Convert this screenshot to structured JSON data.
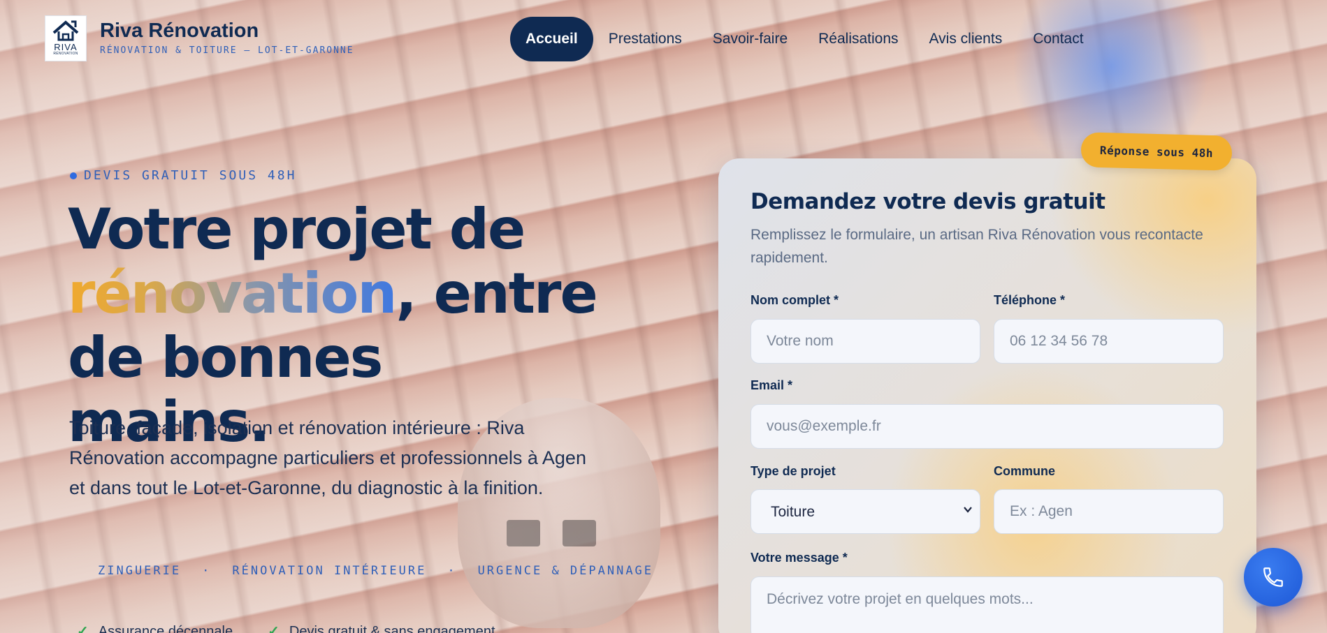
{
  "brand": {
    "name": "Riva Rénovation",
    "tagline": "RÉNOVATION & TOITURE — LOT-ET-GARONNE",
    "logo_word": "RIVA",
    "logo_small": "RÉNOVATION"
  },
  "nav": {
    "items": [
      {
        "label": "Accueil",
        "active": true
      },
      {
        "label": "Prestations"
      },
      {
        "label": "Savoir-faire"
      },
      {
        "label": "Réalisations"
      },
      {
        "label": "Avis clients"
      },
      {
        "label": "Contact"
      }
    ]
  },
  "hero": {
    "eyebrow": "DEVIS GRATUIT SOUS 48H",
    "title_line1": "Votre projet de",
    "title_highlight": "rénovation",
    "title_after_highlight": ", entre",
    "title_line3": "de bonnes mains.",
    "lead": "Toiture, façade, isolation et rénovation intérieure : Riva Rénovation accompagne particuliers et professionnels à Agen et dans tout le Lot-et-Garonne, du diagnostic à la finition.",
    "ticker": [
      "ZINGUERIE",
      "·",
      "RÉNOVATION INTÉRIEURE",
      "·",
      "URGENCE & DÉPANNAGE"
    ],
    "checks": [
      "Assurance décennale",
      "Devis gratuit & sans engagement"
    ]
  },
  "form": {
    "badge": "Réponse sous 48h",
    "title": "Demandez votre devis gratuit",
    "subtitle": "Remplissez le formulaire, un artisan Riva Rénovation vous recontacte rapidement.",
    "name_label": "Nom complet *",
    "name_placeholder": "Votre nom",
    "phone_label": "Téléphone *",
    "phone_placeholder": "06 12 34 56 78",
    "email_label": "Email *",
    "email_placeholder": "vous@exemple.fr",
    "type_label": "Type de projet",
    "type_value": "Toiture",
    "city_label": "Commune",
    "city_placeholder": "Ex : Agen",
    "message_label": "Votre message *",
    "message_placeholder": "Décrivez votre projet en quelques mots..."
  },
  "colors": {
    "navy": "#0f2a52",
    "accent_blue": "#2f6be0",
    "accent_gold": "#f2b02f"
  },
  "icons": {
    "call": "phone-icon",
    "check": "check-icon"
  }
}
